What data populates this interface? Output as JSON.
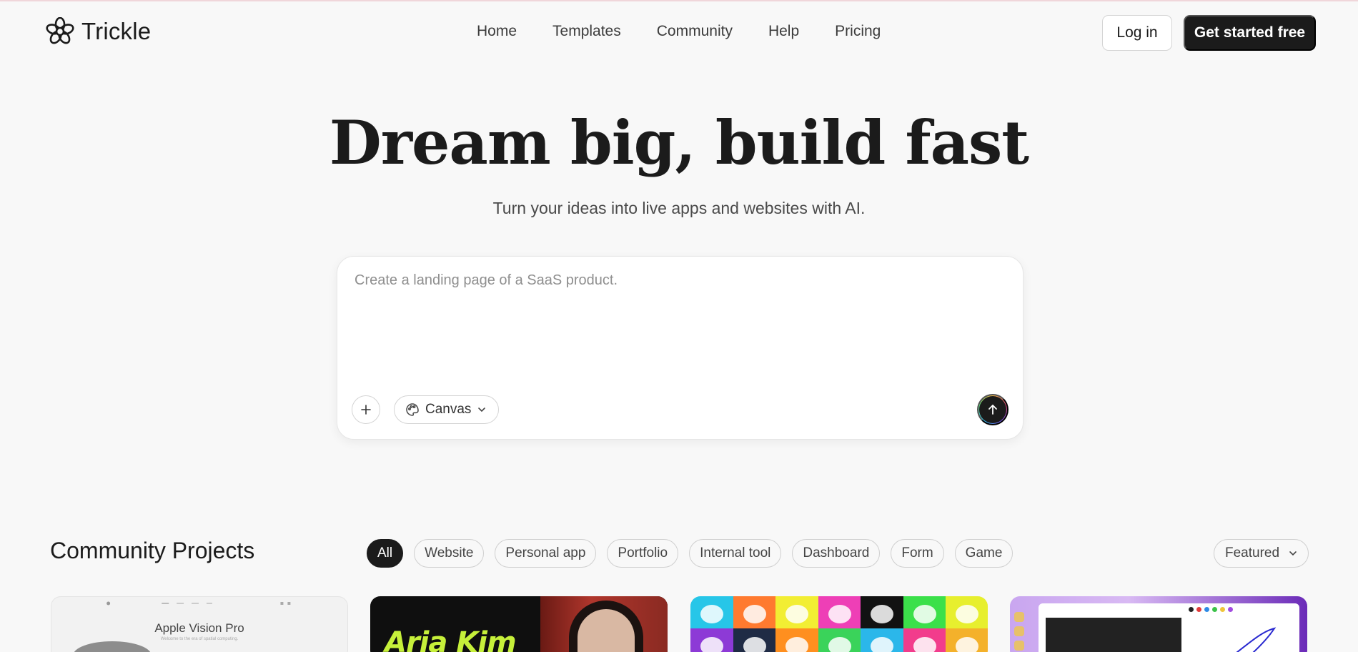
{
  "nav": {
    "brand": "Trickle",
    "links": [
      "Home",
      "Templates",
      "Community",
      "Help",
      "Pricing"
    ],
    "login": "Log in",
    "cta": "Get started free"
  },
  "hero": {
    "title": "Dream big, build fast",
    "subtitle": "Turn your ideas into live apps and websites with AI."
  },
  "prompt": {
    "placeholder": "Create a landing page of a SaaS product.",
    "value": "",
    "mode": "Canvas"
  },
  "community": {
    "title": "Community Projects",
    "filters": [
      "All",
      "Website",
      "Personal app",
      "Portfolio",
      "Internal tool",
      "Dashboard",
      "Form",
      "Game"
    ],
    "active_filter": "All",
    "sort": "Featured",
    "cards": [
      {
        "heading": "Apple Vision Pro",
        "subheading": "Welcome to the era of spatial computing."
      },
      {
        "heading": "Aria Kim"
      },
      {},
      {}
    ]
  },
  "colors": {
    "primary": "#1b1b1b",
    "background": "#f8f8f8",
    "accent_lime": "#c6f03a"
  }
}
